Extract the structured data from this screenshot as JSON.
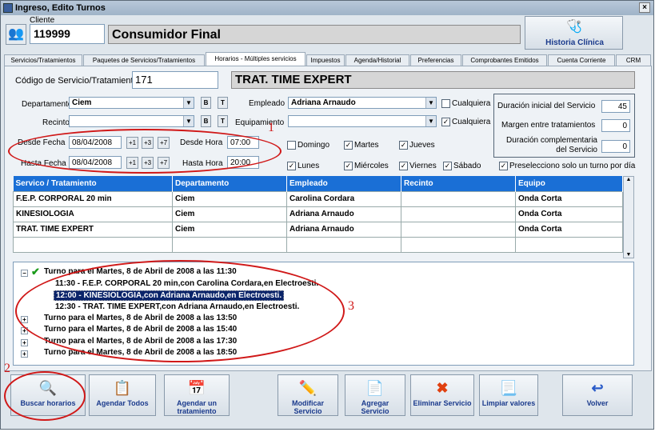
{
  "window": {
    "title": "Ingreso, Edito Turnos",
    "close": "×"
  },
  "cliente": {
    "label": "Cliente",
    "id": "119999",
    "name": "Consumidor Final"
  },
  "historia": {
    "label": "Historia Clínica"
  },
  "tabs": [
    "Servicios/Tratamientos",
    "Paquetes de Servicios/Tratamientos",
    "Horarios - Múltiples servicios",
    "Impuestos",
    "Agenda/Historial",
    "Preferencias",
    "Comprobantes Emitidos",
    "Cuenta Corriente",
    "CRM"
  ],
  "servicio": {
    "label": "Código de Servicio/Tratamiento",
    "code": "171",
    "name": "TRAT. TIME EXPERT"
  },
  "form": {
    "departamento_label": "Departamento",
    "departamento": "Ciem",
    "recinto_label": "Recinto",
    "recinto": "",
    "empleado_label": "Empleado",
    "empleado": "Adriana Arnaudo",
    "equipamiento_label": "Equipamiento",
    "equipamiento": "",
    "cualquiera1": "Cualquiera",
    "cualquiera2": "Cualquiera",
    "b": "B",
    "t": "T",
    "desde_fecha_label": "Desde Fecha",
    "desde_fecha": "08/04/2008",
    "hasta_fecha_label": "Hasta Fecha",
    "hasta_fecha": "08/04/2008",
    "desde_hora_label": "Desde Hora",
    "desde_hora": "07:00",
    "hasta_hora_label": "Hasta Hora",
    "hasta_hora": "20:00",
    "inc1": "+1",
    "inc3": "+3",
    "inc7": "+7"
  },
  "durations": {
    "inicial_label": "Duración inicial del Servicio",
    "inicial": "45",
    "margen_label": "Margen entre tratamientos",
    "margen": "0",
    "compl_label1": "Duración complementaria",
    "compl_label2": "del Servicio",
    "compl": "0"
  },
  "days": {
    "domingo": "Domingo",
    "lunes": "Lunes",
    "martes": "Martes",
    "miercoles": "Miércoles",
    "jueves": "Jueves",
    "viernes": "Viernes",
    "sabado": "Sábado",
    "preselecciono": "Preselecciono solo un turno por día"
  },
  "table": {
    "headers": [
      "Servico / Tratamiento",
      "Departamento",
      "Empleado",
      "Recinto",
      "Equipo"
    ],
    "rows": [
      [
        "F.E.P. CORPORAL 20 min",
        "Ciem",
        "Carolina Cordara",
        "",
        "Onda Corta"
      ],
      [
        "KINESIOLOGIA",
        "Ciem",
        "Adriana Arnaudo",
        "",
        "Onda Corta"
      ],
      [
        "TRAT. TIME EXPERT",
        "Ciem",
        "Adriana Arnaudo",
        "",
        "Onda Corta"
      ],
      [
        "",
        "",
        "",
        "",
        ""
      ]
    ]
  },
  "tree": {
    "root": "Turno para el Martes, 8 de Abril de 2008 a las 11:30",
    "children": [
      "11:30 - F.E.P. CORPORAL 20 min,con Carolina Cordara,en Electroesti.",
      "12:00 - KINESIOLOGIA,con Adriana Arnaudo,en Electroesti.",
      "12:30 - TRAT. TIME EXPERT,con Adriana Arnaudo,en Electroesti."
    ],
    "others": [
      "Turno para el Martes, 8 de Abril de 2008 a las 13:50",
      "Turno para el Martes, 8 de Abril de 2008 a las 15:40",
      "Turno para el Martes, 8 de Abril de 2008 a las 17:30",
      "Turno para el Martes, 8 de Abril de 2008 a las 18:50"
    ]
  },
  "buttons": {
    "buscar": "Buscar horarios",
    "agendar_todos": "Agendar Todos",
    "agendar_uno_1": "Agendar un",
    "agendar_uno_2": "tratamiento",
    "modificar_1": "Modificar",
    "modificar_2": "Servicio",
    "agregar_1": "Agregar",
    "agregar_2": "Servicio",
    "eliminar": "Eliminar Servicio",
    "limpiar": "Limpiar valores",
    "volver": "Volver"
  },
  "annotations": {
    "n1": "1",
    "n2": "2",
    "n3": "3"
  },
  "colors": {
    "accent": "#1a6fd6",
    "annotation": "#d01818"
  }
}
